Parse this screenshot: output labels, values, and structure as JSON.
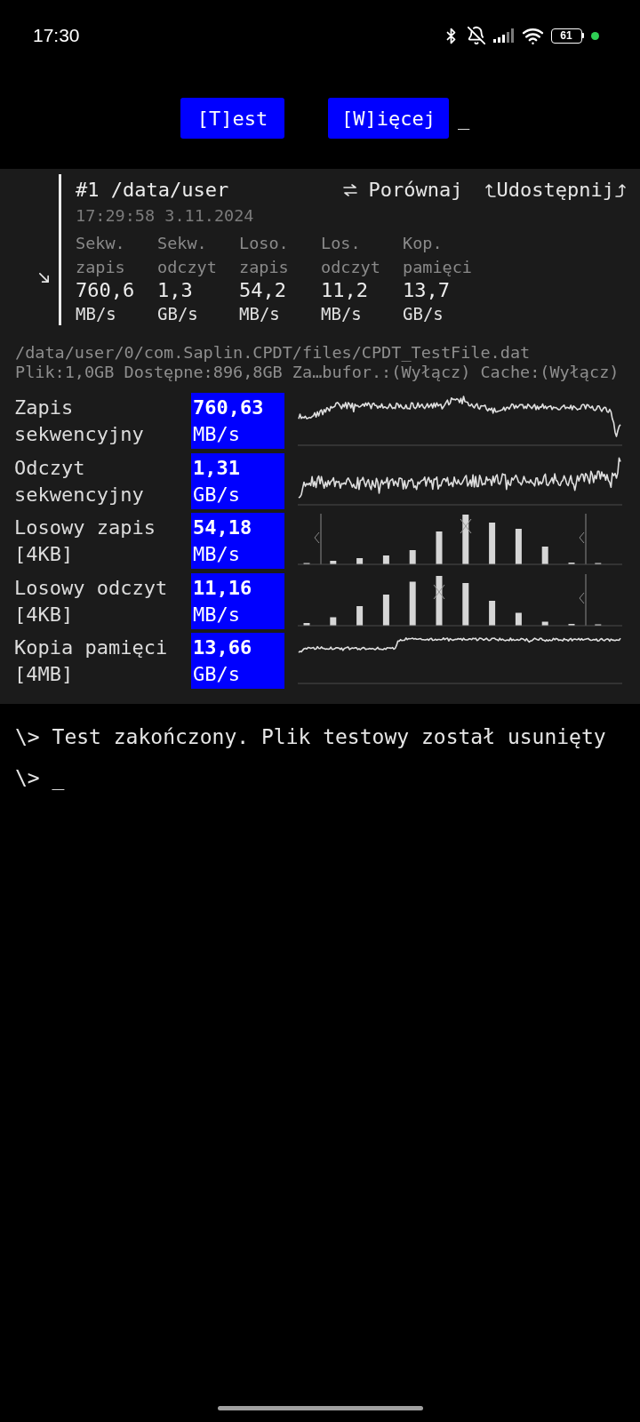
{
  "status_bar": {
    "time": "17:30",
    "battery": "61"
  },
  "toolbar": {
    "buttons": [
      {
        "label": "[T]est"
      },
      {
        "label": "[W]ięcej"
      }
    ],
    "cursor": "_"
  },
  "result_card": {
    "title": "#1 /data/user",
    "actions": [
      {
        "kind": "compare",
        "label": "Porównaj"
      },
      {
        "kind": "share",
        "label": "Udostępnij"
      }
    ],
    "timestamp": "17:29:58 3.11.2024",
    "stats": [
      {
        "label": "Sekw. zapis",
        "value": "760,6",
        "unit": "MB/s"
      },
      {
        "label": "Sekw. odczyt",
        "value": "1,3",
        "unit": "GB/s"
      },
      {
        "label": "Loso. zapis",
        "value": "54,2",
        "unit": "MB/s"
      },
      {
        "label": "Los. odczyt",
        "value": "11,2",
        "unit": "MB/s"
      },
      {
        "label": "Kop. pamięci",
        "value": "13,7",
        "unit": "GB/s"
      }
    ]
  },
  "test_info": {
    "file_path": "/data/user/0/com.Saplin.CPDT/files/CPDT_TestFile.dat",
    "settings": "Plik:1,0GB Dostępne:896,8GB Za…bufor.:(Wyłącz) Cache:(Wyłącz)"
  },
  "results": [
    {
      "name": "Zapis sekwencyjny",
      "value": "760,63",
      "unit": "MB/s",
      "kind": "line"
    },
    {
      "name": "Odczyt sekwencyjny",
      "value": "1,31",
      "unit": "GB/s",
      "kind": "line"
    },
    {
      "name": "Losowy zapis [4KB]",
      "value": "54,18",
      "unit": "MB/s",
      "kind": "histogram"
    },
    {
      "name": "Losowy odczyt [4KB]",
      "value": "11,16",
      "unit": "MB/s",
      "kind": "histogram"
    },
    {
      "name": "Kopia pamięci [4MB]",
      "value": "13,66",
      "unit": "GB/s",
      "kind": "line"
    }
  ],
  "console": {
    "lines": [
      "\\> Test zakończony. Plik testowy został usunięty",
      "\\> _"
    ]
  }
}
